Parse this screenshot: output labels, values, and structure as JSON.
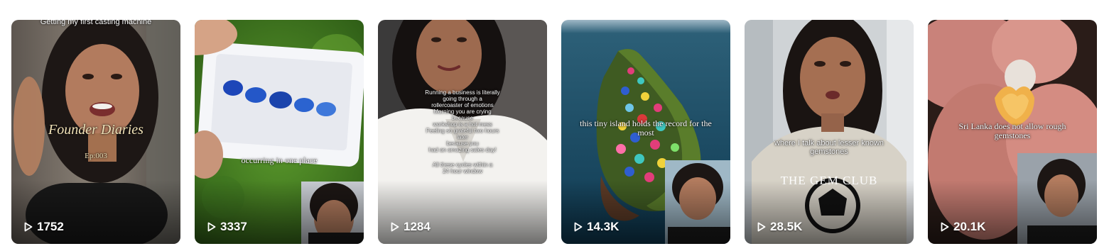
{
  "videos": [
    {
      "views": "1752",
      "caption_top": "Getting my first casting machine",
      "title": "Founder Diaries",
      "subtitle": "Ep:003"
    },
    {
      "views": "3337",
      "caption": "occurring in one place"
    },
    {
      "views": "1284",
      "caption_lines": [
        "Running a business is literally",
        "going through a",
        "rollercoaster of emotions",
        "Morning you are crying",
        "because",
        "workshop is a hot mess",
        "Feeling so grateful two hours",
        "later",
        "because you",
        "had an amazing sales day!"
      ],
      "caption_tail": "All these cycles within a 24 hour window"
    },
    {
      "views": "14.3K",
      "caption": "this tiny island holds the record for the most"
    },
    {
      "views": "28.5K",
      "caption": "where I talk about lesser known gemstones",
      "shirt_text": "THE GEM CLUB"
    },
    {
      "views": "20.1K",
      "caption": "Sri Lanka does not allow rough gemstones"
    }
  ],
  "icons": {
    "play": "play-icon"
  },
  "colors": {
    "overlay_text": "#ffffff",
    "background": "#ffffff"
  }
}
